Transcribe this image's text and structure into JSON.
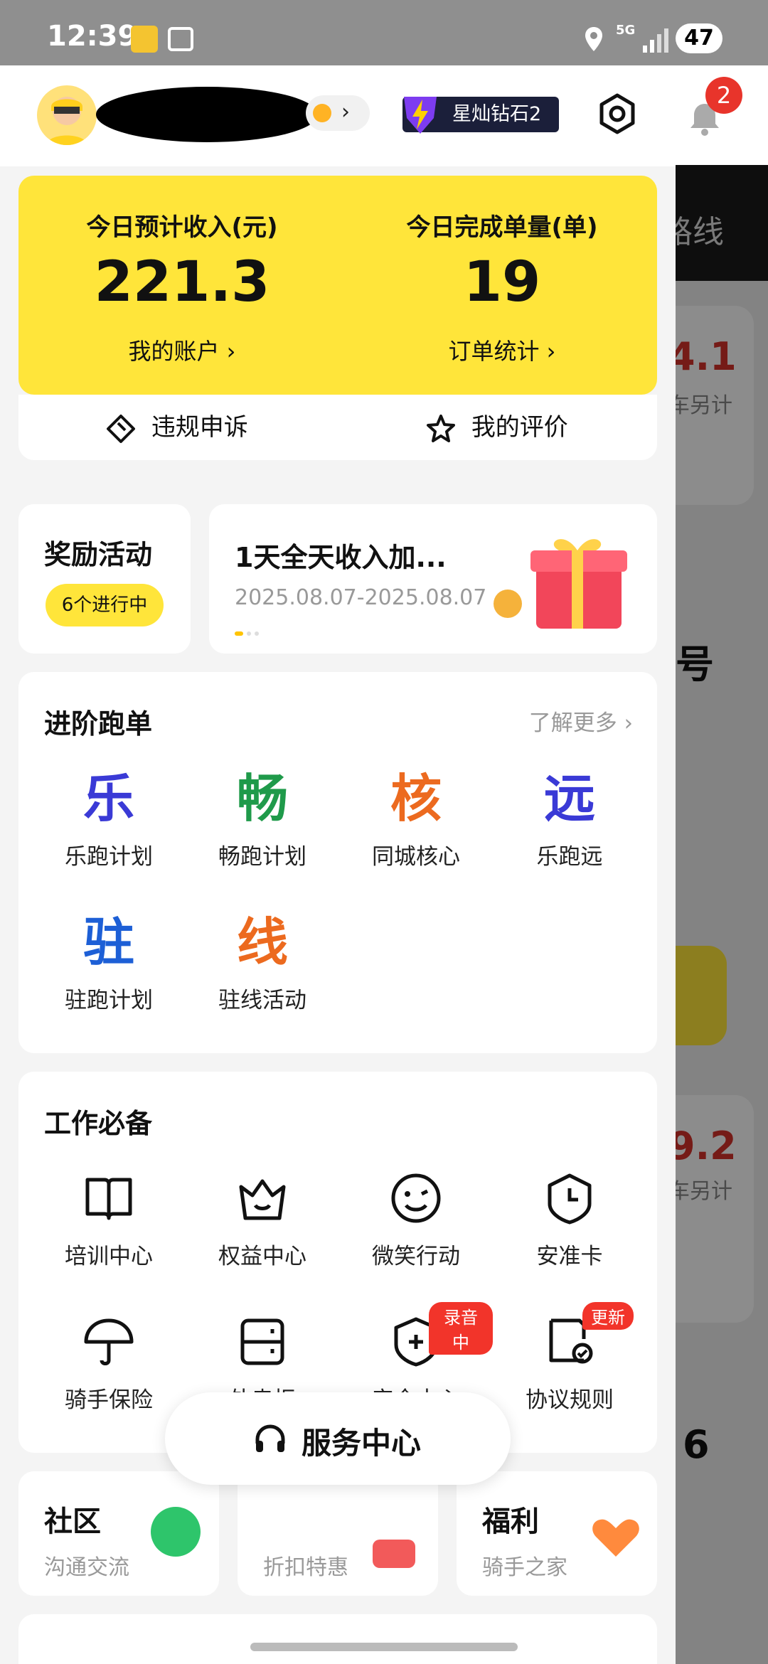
{
  "status_bar": {
    "time": "12:39",
    "network": "5G",
    "battery": "47"
  },
  "profile": {
    "level_badge": "星灿钻石2"
  },
  "background_app": {
    "notification_count": "2",
    "header_fragment": "路线",
    "value_a": "4.1",
    "sub_a": "车另计",
    "label_mid": "号",
    "value_b": "9.2",
    "sub_b": "车另计",
    "value_c": "6"
  },
  "earnings": {
    "income_label": "今日预计收入(元)",
    "income_value": "221.3",
    "income_link": "我的账户 ›",
    "orders_label": "今日完成单量(单)",
    "orders_value": "19",
    "orders_link": "订单统计 ›"
  },
  "actions": {
    "appeal": "违规申诉",
    "rating": "我的评价"
  },
  "rewards": {
    "title": "奖励活动",
    "badge": "6个进行中",
    "banner_title": "1天全天收入加...",
    "banner_date": "2025.08.07-2025.08.07"
  },
  "advanced": {
    "title": "进阶跑单",
    "more": "了解更多 ›",
    "items": [
      {
        "glyph": "乐",
        "label": "乐跑计划",
        "color": "#3a3ad6"
      },
      {
        "glyph": "畅",
        "label": "畅跑计划",
        "color": "#1f9a4a"
      },
      {
        "glyph": "核",
        "label": "同城核心",
        "color": "#ec6a1f"
      },
      {
        "glyph": "远",
        "label": "乐跑远",
        "color": "#3a3ad6"
      },
      {
        "glyph": "驻",
        "label": "驻跑计划",
        "color": "#1d5fd6"
      },
      {
        "glyph": "线",
        "label": "驻线活动",
        "color": "#ec6a1f"
      }
    ]
  },
  "work": {
    "title": "工作必备",
    "items": [
      {
        "label": "培训中心",
        "icon": "book-icon"
      },
      {
        "label": "权益中心",
        "icon": "crown-icon"
      },
      {
        "label": "微笑行动",
        "icon": "smile-icon"
      },
      {
        "label": "安准卡",
        "icon": "clock-shield-icon"
      },
      {
        "label": "骑手保险",
        "icon": "umbrella-icon"
      },
      {
        "label": "外卖柜",
        "icon": "locker-icon"
      },
      {
        "label": "安全中心",
        "icon": "shield-plus-icon",
        "tag": "录音中"
      },
      {
        "label": "协议规则",
        "icon": "document-check-icon",
        "tag": "更新"
      }
    ]
  },
  "bottom_cards": {
    "community_title": "社区",
    "community_sub": "沟通交流",
    "deals_sub": "折扣特惠",
    "welfare_title": "福利",
    "welfare_sub": "骑手之家"
  },
  "service_center": {
    "label": "服务中心"
  }
}
